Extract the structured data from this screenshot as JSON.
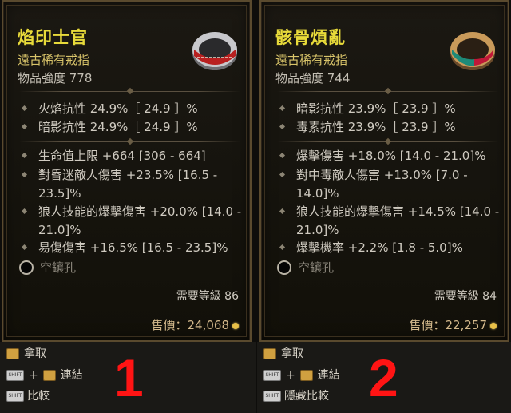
{
  "items": [
    {
      "name": "焰印士官",
      "type": "遠古稀有戒指",
      "power": "物品強度 778",
      "implicit": [
        "火焰抗性 24.9%［ 24.9 ］%",
        "暗影抗性 24.9%［ 24.9 ］%"
      ],
      "affixes": [
        [
          "生命值上限 +664 [306 - 664]"
        ],
        [
          "對昏迷敵人傷害 +23.5% [16.5 -",
          "23.5]%"
        ],
        [
          "狼人技能的爆擊傷害 +20.0% [14.0 -",
          "21.0]%"
        ],
        [
          "易傷傷害 +16.5% [16.5 - 23.5]%"
        ]
      ],
      "socket": "空鑲孔",
      "required_level": "需要等級 86",
      "price_label": "售價：",
      "price": "24,068"
    },
    {
      "name": "骸骨煩亂",
      "type": "遠古稀有戒指",
      "power": "物品強度 744",
      "implicit": [
        "暗影抗性 23.9%［ 23.9 ］%",
        "毒素抗性 23.9%［ 23.9 ］%"
      ],
      "affixes": [
        [
          "爆擊傷害 +18.0% [14.0 - 21.0]%"
        ],
        [
          "對中毒敵人傷害 +13.0% [7.0 -",
          "14.0]%"
        ],
        [
          "狼人技能的爆擊傷害 +14.5% [14.0 -",
          "21.0]%"
        ],
        [
          "爆擊機率 +2.2% [1.8 - 5.0]%"
        ]
      ],
      "socket": "空鑲孔",
      "required_level": "需要等級 84",
      "price_label": "售價：",
      "price": "22,257"
    }
  ],
  "footers": [
    {
      "take": "拿取",
      "link": "連結",
      "compare": "比較",
      "plus": "+",
      "number": "1"
    },
    {
      "take": "拿取",
      "link": "連結",
      "compare": "隱藏比較",
      "plus": "+",
      "number": "2"
    }
  ],
  "colors": {
    "title": "#e8da3a",
    "type": "#d9c46a",
    "number": "#ff1414"
  },
  "icons": {
    "ring_1": "silver-red-ring-icon",
    "ring_2": "gold-red-green-ring-icon",
    "socket": "empty-socket-icon",
    "coin": "gold-coin-icon",
    "take": "mouse-key-icon",
    "shift": "shift-key-icon"
  }
}
